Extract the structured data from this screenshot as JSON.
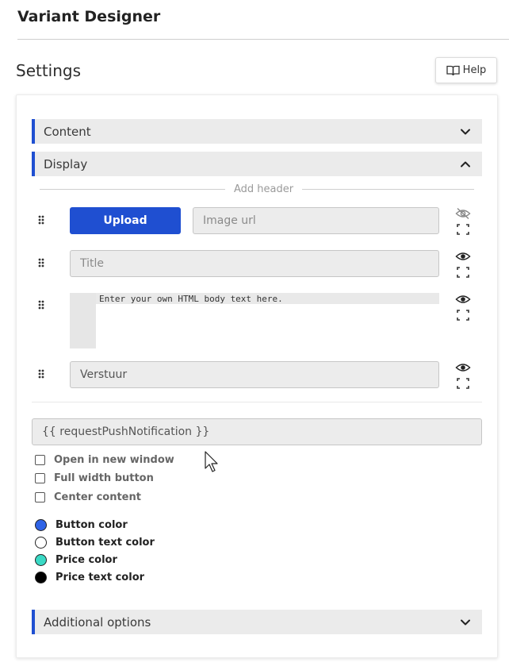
{
  "header": {
    "title": "Variant Designer"
  },
  "settings": {
    "title": "Settings",
    "help_label": "Help"
  },
  "accordions": {
    "content": "Content",
    "display": "Display",
    "additional": "Additional options"
  },
  "display": {
    "add_header": "Add header",
    "upload_label": "Upload",
    "image_url_placeholder": "Image url",
    "title_placeholder": "Title",
    "body_placeholder": "Enter your own HTML body text here.",
    "button_value": "Verstuur",
    "action_value": "{{ requestPushNotification }}",
    "checkboxes": [
      "Open in new window",
      "Full width button",
      "Center content"
    ],
    "colors": [
      {
        "label": "Button color",
        "value": "#2f63e6"
      },
      {
        "label": "Button text color",
        "value": "#ffffff"
      },
      {
        "label": "Price color",
        "value": "#3ad9c5"
      },
      {
        "label": "Price text color",
        "value": "#000000"
      }
    ]
  },
  "icons": {
    "help": "book-icon",
    "row1_visibility": "eye-off-icon",
    "visibility": "eye-icon",
    "fullscreen": "fullscreen-icon",
    "drag": "drag-handle-icon",
    "collapsed": "chevron-down-icon",
    "expanded": "chevron-up-icon"
  }
}
